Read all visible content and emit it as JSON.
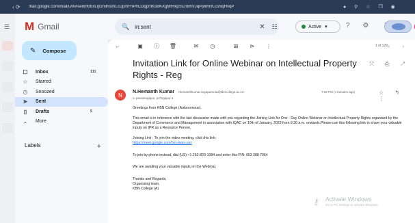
{
  "browser": {
    "url": "mail.google.com/mail/u/0/#sent/KtbxLrjGmlNsmLcDpmFhPhCDqpmKsBKXgMfRkpSCnBhVJqPpWmfLcsNqHvqP",
    "nav_icons": "‹ ⟳",
    "tool_icons": "● ⚲ ☆ ❐ ◉"
  },
  "app": {
    "logo_letter": "M",
    "name": "Gmail",
    "menu_icon": "☰"
  },
  "search": {
    "query": "in:sent",
    "search_glyph": "🔍",
    "clear_glyph": "✕",
    "filter_glyph": "☷"
  },
  "status": {
    "label": "Active",
    "arrow": "▾",
    "color": "#1e8e3e"
  },
  "header_icons": "? ⚙ ⋮⋮",
  "sidebar": {
    "compose_icon": "✎",
    "compose_label": "Compose",
    "items": [
      {
        "icon": "☐",
        "label": "Inbox",
        "count": "111"
      },
      {
        "icon": "☆",
        "label": "Starred",
        "count": ""
      },
      {
        "icon": "◷",
        "label": "Snoozed",
        "count": ""
      },
      {
        "icon": "➤",
        "label": "Sent",
        "count": ""
      },
      {
        "icon": "▯",
        "label": "Drafts",
        "count": "5"
      },
      {
        "icon": "⌄",
        "label": "More",
        "count": ""
      }
    ],
    "labels_title": "Labels",
    "labels_add": "+"
  },
  "toolbar": {
    "back": "←",
    "icons": [
      "▣",
      "ⓘ",
      "🗑",
      "✉",
      "◷",
      "⊞",
      "⊳",
      "⋮"
    ],
    "pager": "1 of 129",
    "pager_arrows": "‹ ›"
  },
  "email": {
    "subject": "Invitation Link for Online Webinar on Intellectual Property Rights - Reg",
    "subject_icons": "⤧ ⎙ ↗",
    "avatar_letter": "N",
    "sender_name": "N.Hemanth Kumar",
    "sender_email": "<hemanthkumar.nayapamula@kbncollege.ac.in>",
    "to": "to pavantogapur, psTogapur ▾",
    "time": "7:22 PM (4 minutes ago)",
    "reply_icons": "☆ ↰ ⋮",
    "greeting": "Greetings from KBN College (Autonomous).",
    "paragraph": "This email is in reference with the last discussion made with you regarding the Joining Link for One - Day Online Webinar on Intellectual Property Rights organised by the Department of Commerce and Management in association with IQAC  on 10th of January, 2023 from 8.30 a.m. onwards.Please use this following link to share your valuable inputs on IPR as a Resource Person.",
    "joining": "Joining Link : To join the video meeting, click this link:",
    "link": "https://meet.google.com/fxo-xwss-usz",
    "phone": "To join by phone instead, dial (US) +1 252-820-1084 and enter this PIN: 953 388 795#",
    "awaiting": "We are awaiting your valuable inputs on the Webinar.",
    "regards": "Thanks and Regards,",
    "team": "Organising team,",
    "college": "KBN College (A)"
  },
  "watermark": {
    "key_glyph": "⚷",
    "title": "Activate Windows",
    "subtitle": "Go to PC settings to activate Windows."
  }
}
